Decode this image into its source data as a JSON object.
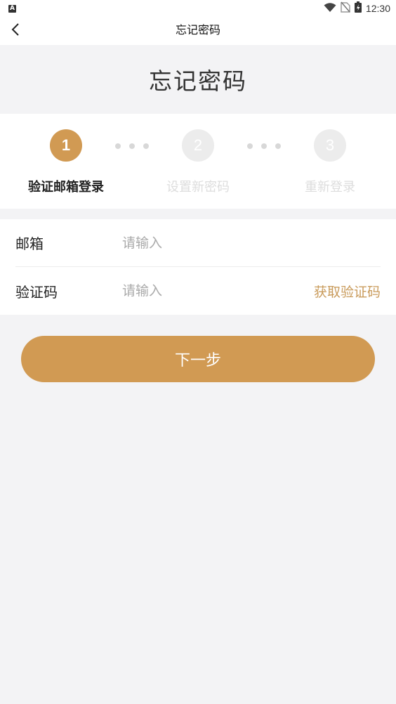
{
  "status_bar": {
    "badge": "A",
    "time": "12:30",
    "icons": [
      "wifi-icon",
      "no-sim-icon",
      "battery-charging-icon"
    ]
  },
  "nav": {
    "title": "忘记密码",
    "back_icon": "back-arrow-icon"
  },
  "hero": {
    "title": "忘记密码"
  },
  "steps": [
    {
      "number": "1",
      "label": "验证邮箱登录",
      "active": true
    },
    {
      "number": "2",
      "label": "设置新密码",
      "active": false
    },
    {
      "number": "3",
      "label": "重新登录",
      "active": false
    }
  ],
  "form": {
    "email_label": "邮箱",
    "email_placeholder": "请输入",
    "code_label": "验证码",
    "code_placeholder": "请输入",
    "get_code_label": "获取验证码"
  },
  "next_button": "下一步",
  "colors": {
    "accent": "#d19a53",
    "link": "#c99b5b",
    "background": "#f3f3f5",
    "inactive_circle": "#ececec",
    "inactive_text": "#dddddd"
  }
}
